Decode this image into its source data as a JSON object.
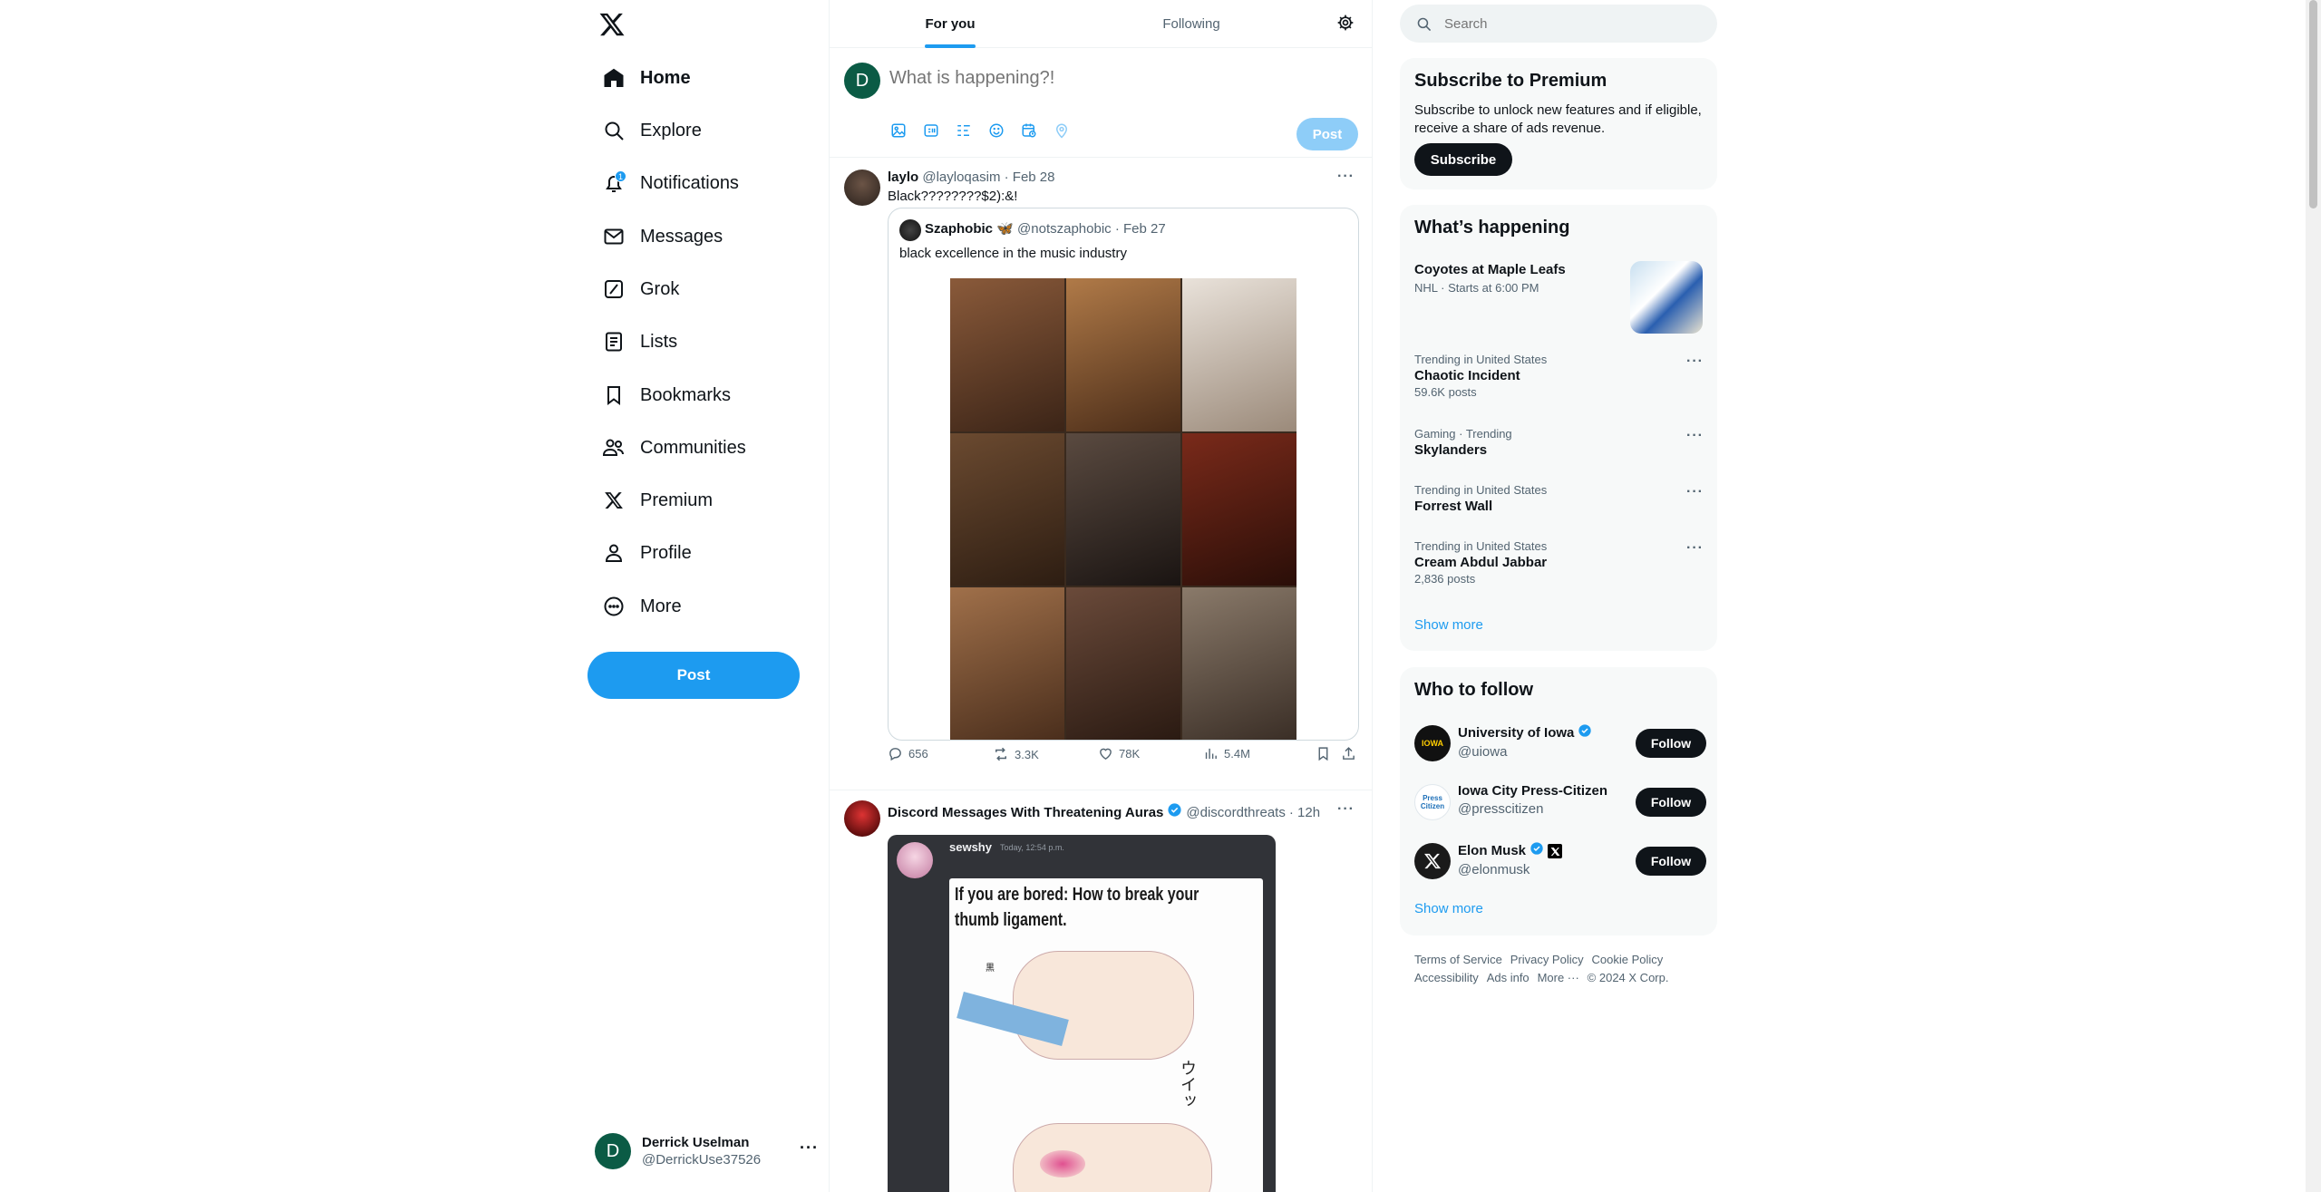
{
  "nav": {
    "items": [
      {
        "label": "Home",
        "icon": "home-icon"
      },
      {
        "label": "Explore",
        "icon": "search-icon"
      },
      {
        "label": "Notifications",
        "icon": "bell-icon",
        "badge": "1"
      },
      {
        "label": "Messages",
        "icon": "mail-icon"
      },
      {
        "label": "Grok",
        "icon": "grok-icon"
      },
      {
        "label": "Lists",
        "icon": "list-icon"
      },
      {
        "label": "Bookmarks",
        "icon": "bookmark-icon"
      },
      {
        "label": "Communities",
        "icon": "people-icon"
      },
      {
        "label": "Premium",
        "icon": "x-logo-icon"
      },
      {
        "label": "Profile",
        "icon": "person-icon"
      },
      {
        "label": "More",
        "icon": "more-circle-icon"
      }
    ],
    "post_label": "Post"
  },
  "account": {
    "initial": "D",
    "name": "Derrick Uselman",
    "handle": "@DerrickUse37526"
  },
  "tabs": {
    "for_you": "For you",
    "following": "Following"
  },
  "composer": {
    "avatar": "D",
    "placeholder": "What is happening?!",
    "post_label": "Post"
  },
  "tweets": [
    {
      "name": "laylo",
      "handle": "@layloqasim",
      "time": "· Feb 28",
      "text": "Black????????$2):&!",
      "quote": {
        "name": "Szaphobic",
        "emoji": "🦋",
        "handle": "@notszaphobic",
        "time": "· Feb 27",
        "text": "black excellence in the music industry"
      },
      "replies": "656",
      "reposts": "3.3K",
      "likes": "78K",
      "views": "5.4M"
    },
    {
      "name": "Discord Messages With Threatening Auras",
      "handle": "@discordthreats",
      "time": "· 12h",
      "card": {
        "user": "sewshy",
        "timestamp": "Today, 12:54 p.m.",
        "image_title": "If you are bored: How to break your thumb ligament.",
        "image_label_1": "ウイッ",
        "image_label_2": "黒"
      }
    }
  ],
  "search": {
    "placeholder": "Search"
  },
  "premium": {
    "title": "Subscribe to Premium",
    "text": "Subscribe to unlock new features and if eligible, receive a share of ads revenue.",
    "button": "Subscribe"
  },
  "happening": {
    "title": "What’s happening",
    "event": {
      "name": "Coyotes at Maple Leafs",
      "meta": "NHL · Starts at 6:00 PM"
    },
    "trends": [
      {
        "context": "Trending in United States",
        "name": "Chaotic Incident",
        "posts": "59.6K posts"
      },
      {
        "context": "Gaming · Trending",
        "name": "Skylanders",
        "posts": ""
      },
      {
        "context": "Trending in United States",
        "name": "Forrest Wall",
        "posts": ""
      },
      {
        "context": "Trending in United States",
        "name": "Cream Abdul Jabbar",
        "posts": "2,836 posts"
      }
    ],
    "show_more": "Show more"
  },
  "who_to_follow": {
    "title": "Who to follow",
    "accounts": [
      {
        "name": "University of Iowa",
        "handle": "@uiowa",
        "avatar_text": "IOWA"
      },
      {
        "name": "Iowa City Press-Citizen",
        "handle": "@presscitizen",
        "avatar_text": "Press Citizen"
      },
      {
        "name": "Elon Musk",
        "handle": "@elonmusk",
        "avatar_text": ""
      }
    ],
    "follow_label": "Follow",
    "show_more": "Show more"
  },
  "footer": {
    "links": [
      "Terms of Service",
      "Privacy Policy",
      "Cookie Policy",
      "Accessibility",
      "Ads info",
      "More ···"
    ],
    "copyright": "© 2024 X Corp."
  },
  "colors": {
    "accent": "#1d9bf0",
    "text": "#0f1419",
    "muted": "#536471",
    "avatar": "#0b5b45"
  }
}
